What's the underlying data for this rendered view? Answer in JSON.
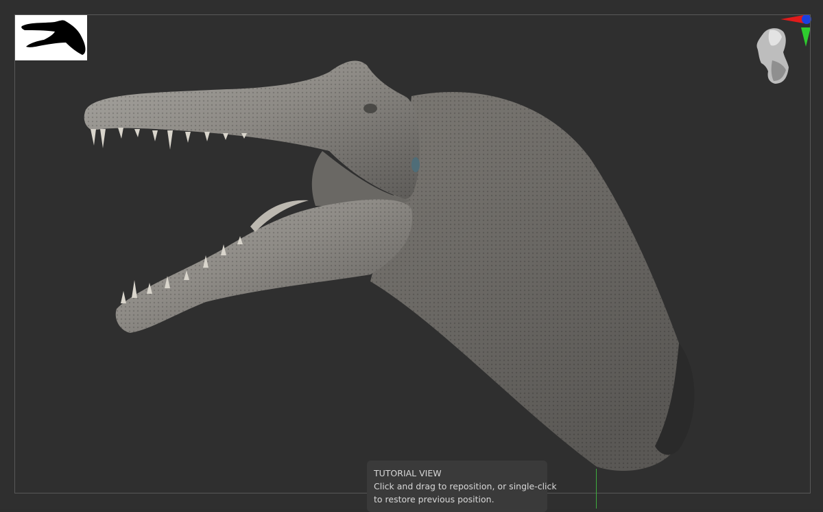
{
  "tooltip": {
    "title": "TUTORIAL VIEW",
    "line1": "Click and drag to reposition, or single-click",
    "line2": "to restore previous position."
  },
  "icons": {
    "thumbnail": "model-silhouette-thumbnail",
    "navigator": "navigation-head-icon",
    "axes": "axis-gizmo-icon"
  },
  "colors": {
    "background": "#2f2f2f",
    "model": "#8a8782",
    "axis_x": "#e01b1b",
    "axis_y": "#2ecc2e",
    "axis_z": "#1b3fe0"
  }
}
